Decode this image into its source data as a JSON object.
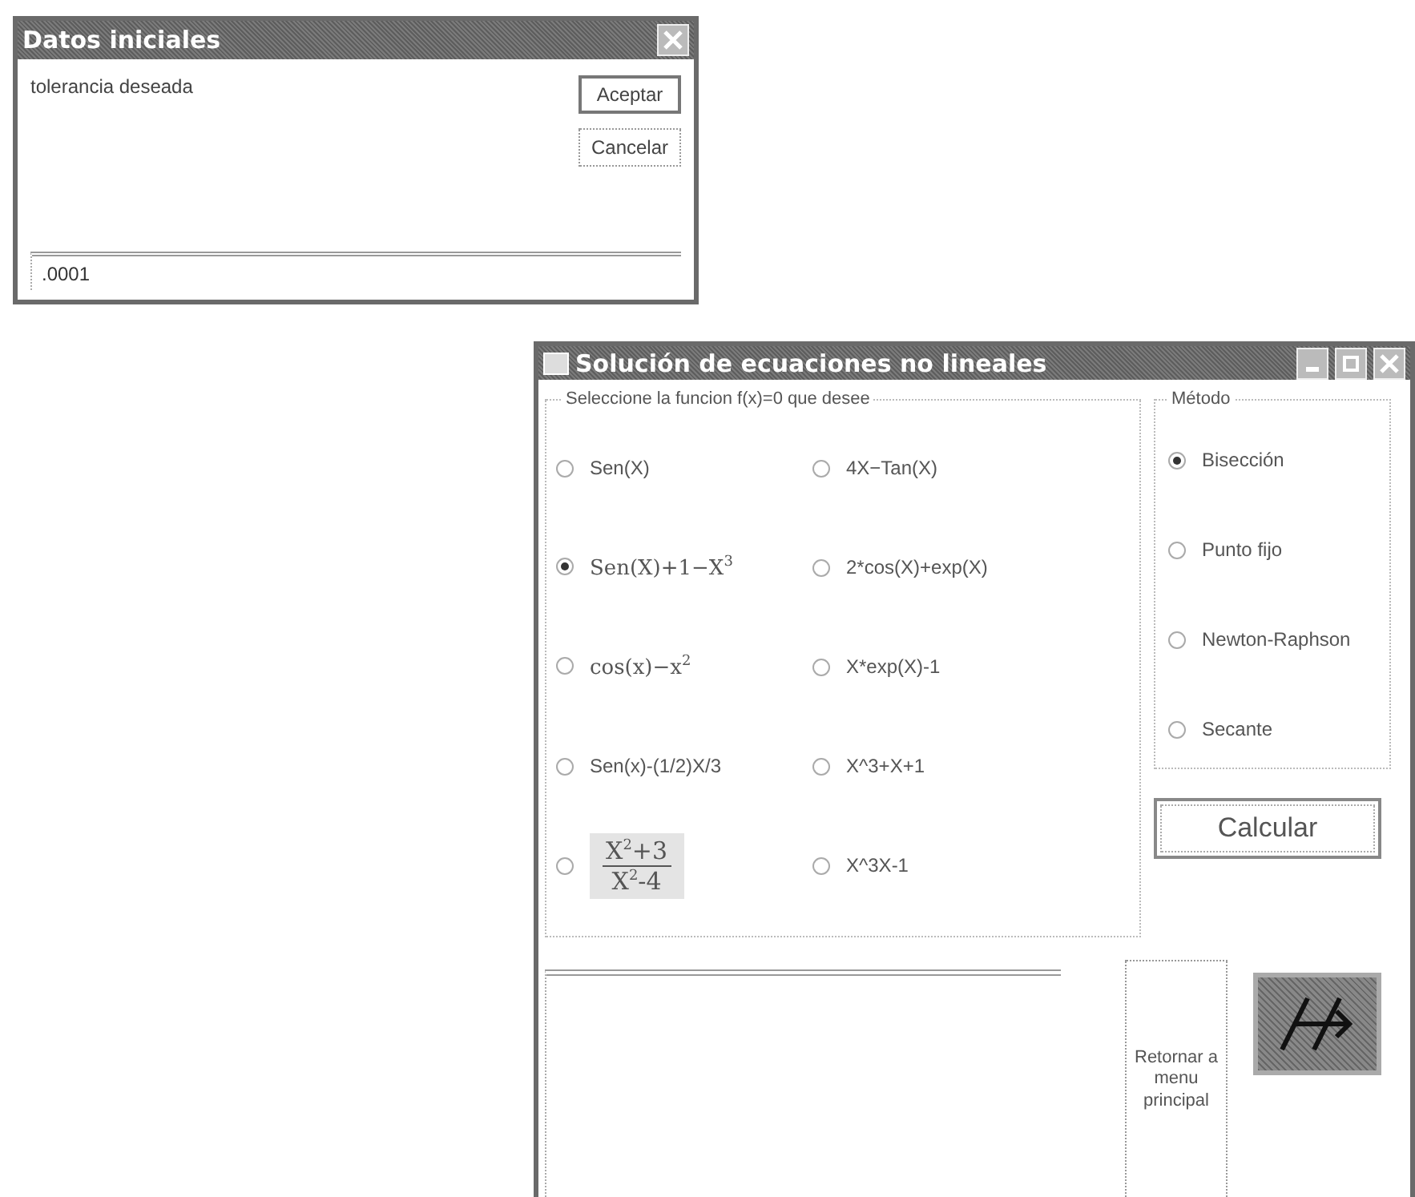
{
  "dialog": {
    "title": "Datos iniciales",
    "prompt": "tolerancia deseada",
    "buttons": [
      {
        "label": "Aceptar",
        "kind": "default"
      },
      {
        "label": "Cancelar",
        "kind": "normal"
      }
    ],
    "input": {
      "value": ".0001"
    }
  },
  "main_window": {
    "title": "Solución de ecuaciones no lineales",
    "functions_group": {
      "title": "Seleccione la funcion f(x)=0 que desee",
      "options": [
        {
          "kind": "text",
          "label": "Sen(X)",
          "selected": false
        },
        {
          "kind": "text",
          "label": "4X−Tan(X)",
          "selected": false
        },
        {
          "kind": "text",
          "label": "Sen(X)+1−X$^{3}$",
          "selected": true
        },
        {
          "kind": "text",
          "label": "2*cos(X)+exp(X)",
          "selected": false
        },
        {
          "kind": "text",
          "label": "cos(x)−x$^{2}$",
          "selected": false
        },
        {
          "kind": "text",
          "label": "X*exp(X)-1",
          "selected": false
        },
        {
          "kind": "text",
          "label": "Sen(x)-(1/2)X/3",
          "selected": false
        },
        {
          "kind": "text",
          "label": "X^3+X+1",
          "selected": false
        },
        {
          "kind": "fraction",
          "numerator": "X$^{2}$+3",
          "denominator": "X$^{2}$-4",
          "selected": false
        },
        {
          "kind": "text",
          "label": "X^3X-1",
          "selected": false
        }
      ]
    },
    "method_group": {
      "title": "Método",
      "options": [
        {
          "label": "Bisección",
          "selected": true
        },
        {
          "label": "Punto fijo",
          "selected": false
        },
        {
          "label": "Newton-Raphson",
          "selected": false
        },
        {
          "label": "Secante",
          "selected": false
        }
      ]
    },
    "calculate_button": "Calcular",
    "return_button": "Retornar a menu principal"
  }
}
